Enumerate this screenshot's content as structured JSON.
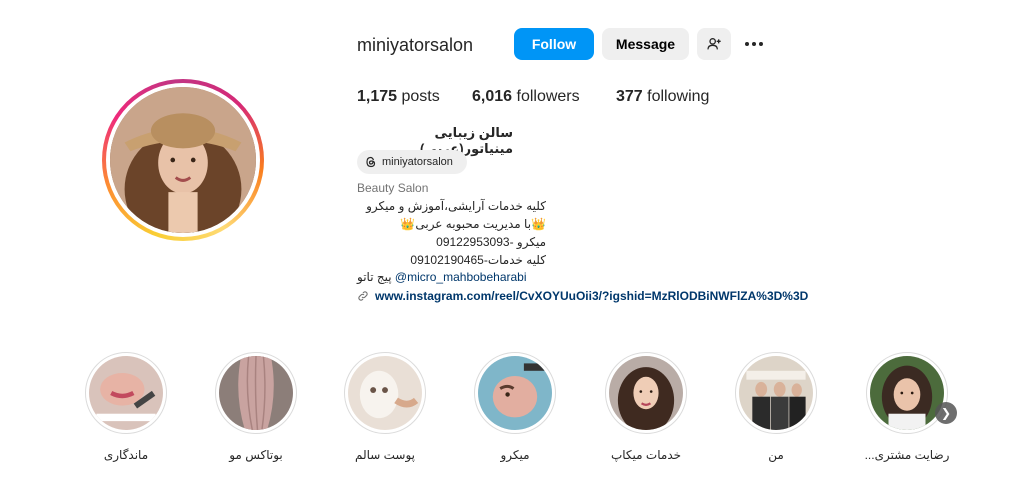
{
  "profile": {
    "username": "miniyatorsalon",
    "follow_label": "Follow",
    "message_label": "Message",
    "add_user_icon": "add-user-icon",
    "more_icon": "more-options-icon",
    "stats": {
      "posts_count": "1,175",
      "posts_label": "posts",
      "followers_count": "6,016",
      "followers_label": "followers",
      "following_count": "377",
      "following_label": "following"
    },
    "full_name": "سالن زیبایی مینیاتور(عربی)",
    "threads_handle": "miniyatorsalon",
    "category": "Beauty Salon",
    "bio_lines": [
      "کلیه خدمات آرایشی،آموزش و میکرو",
      "👑با مدیریت محبوبه عربی👑",
      "میکرو -09122953093",
      "کلیه خدمات-09102190465"
    ],
    "bio_mention_prefix": "پیج تاتو",
    "bio_mention": "@micro_mahbobeharabi",
    "link": "www.instagram.com/reel/CvXOYUuOii3/?igshid=MzRlODBiNWFlZA%3D%3D"
  },
  "highlights": [
    {
      "label": "ماندگاری"
    },
    {
      "label": "بوتاکس مو"
    },
    {
      "label": "پوست سالم"
    },
    {
      "label": "میکرو"
    },
    {
      "label": "خدمات میکاپ"
    },
    {
      "label": "من"
    },
    {
      "label": "رضایت مشتری..."
    }
  ],
  "colors": {
    "follow_button": "#0095f6",
    "secondary_button": "#efefef",
    "link": "#00376b",
    "muted_text": "#737373"
  }
}
